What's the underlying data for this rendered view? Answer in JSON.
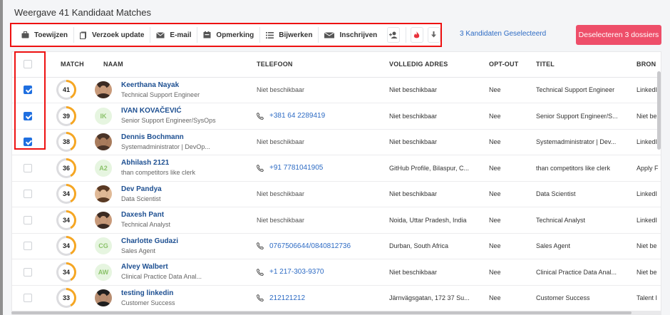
{
  "page": {
    "title": "Weergave 41 Kandidaat Matches"
  },
  "toolbar": {
    "assign_label": "Toewijzen",
    "request_update_label": "Verzoek update",
    "email_label": "E-mail",
    "note_label": "Opmerking",
    "edit_label": "Bijwerken",
    "enroll_label": "Inschrijven",
    "icons": [
      "briefcase-icon",
      "document-icon",
      "envelope-icon",
      "note-icon",
      "list-icon",
      "mailbox-icon",
      "add-person-icon",
      "flame-icon",
      "download-icon"
    ]
  },
  "selection": {
    "count_label": "3 Kandidaten Geselecteerd",
    "deselect_label": "Deselecteren 3 dossiers"
  },
  "table": {
    "columns": {
      "match": "MATCH",
      "name": "NAAM",
      "phone": "TELEFOON",
      "address": "VOLLEDIG ADRES",
      "optout": "OPT-OUT",
      "title": "TITEL",
      "source": "BRON"
    },
    "rows": [
      {
        "checked": true,
        "match": "41",
        "match_pct": 0.41,
        "name": "Keerthana Nayak",
        "subtitle": "Technical Support Engineer",
        "avatar": "photo",
        "initials": "",
        "phone": "Niet beschikbaar",
        "phone_available": false,
        "address": "Niet beschikbaar",
        "optout": "Nee",
        "title": "Technical Support Engineer",
        "source": "LinkedI"
      },
      {
        "checked": true,
        "match": "39",
        "match_pct": 0.39,
        "name": "IVAN KOVAČEVIĆ",
        "subtitle": "Senior Support Engineer/SysOps",
        "avatar": "initials",
        "initials": "IK",
        "phone": "+381 64 2289419",
        "phone_available": true,
        "address": "Niet beschikbaar",
        "optout": "Nee",
        "title": "Senior Support Engineer/S...",
        "source": "Niet be"
      },
      {
        "checked": true,
        "match": "38",
        "match_pct": 0.38,
        "name": "Dennis Bochmann",
        "subtitle": "Systemadministrator | DevOp...",
        "avatar": "photo",
        "initials": "",
        "phone": "Niet beschikbaar",
        "phone_available": false,
        "address": "Niet beschikbaar",
        "optout": "Nee",
        "title": "Systemadministrator | Dev...",
        "source": "LinkedI"
      },
      {
        "checked": false,
        "match": "36",
        "match_pct": 0.36,
        "name": "Abhilash 2121",
        "subtitle": "than competitors like clerk",
        "avatar": "initials",
        "initials": "A2",
        "phone": "+91 7781041905",
        "phone_available": true,
        "address": "GitHub Profile, Bilaspur, C...",
        "optout": "Nee",
        "title": "than competitors like clerk",
        "source": "Apply F"
      },
      {
        "checked": false,
        "match": "34",
        "match_pct": 0.34,
        "name": "Dev Pandya",
        "subtitle": "Data Scientist",
        "avatar": "photo",
        "initials": "",
        "phone": "Niet beschikbaar",
        "phone_available": false,
        "address": "Niet beschikbaar",
        "optout": "Nee",
        "title": "Data Scientist",
        "source": "LinkedI"
      },
      {
        "checked": false,
        "match": "34",
        "match_pct": 0.34,
        "name": "Daxesh Pant",
        "subtitle": "Technical Analyst",
        "avatar": "photo",
        "initials": "",
        "phone": "Niet beschikbaar",
        "phone_available": false,
        "address": "Noida, Uttar Pradesh, India",
        "optout": "Nee",
        "title": "Technical Analyst",
        "source": "LinkedI"
      },
      {
        "checked": false,
        "match": "34",
        "match_pct": 0.34,
        "name": "Charlotte Gudazi",
        "subtitle": "Sales Agent",
        "avatar": "initials",
        "initials": "CG",
        "phone": "0767506644/0840812736",
        "phone_available": true,
        "address": "Durban, South Africa",
        "optout": "Nee",
        "title": "Sales Agent",
        "source": "Niet be"
      },
      {
        "checked": false,
        "match": "34",
        "match_pct": 0.34,
        "name": "Alvey Walbert",
        "subtitle": "Clinical Practice Data Anal...",
        "avatar": "initials",
        "initials": "AW",
        "phone": "+1 217-303-9370",
        "phone_available": true,
        "address": "Niet beschikbaar",
        "optout": "Nee",
        "title": "Clinical Practice Data Anal...",
        "source": "Niet be"
      },
      {
        "checked": false,
        "match": "33",
        "match_pct": 0.33,
        "name": "testing linkedin",
        "subtitle": "Customer Success",
        "avatar": "photo",
        "initials": "",
        "phone": "212121212",
        "phone_available": true,
        "address": "Järnvägsgatan, 172 37 Su...",
        "optout": "Nee",
        "title": "Customer Success",
        "source": "Talent I"
      }
    ]
  },
  "colors": {
    "accent_blue": "#1f6fe0",
    "link_blue": "#2d6bc4",
    "match_ring": "#f5a623",
    "deselect_button": "#ee4e69",
    "highlight_red": "#e11"
  }
}
